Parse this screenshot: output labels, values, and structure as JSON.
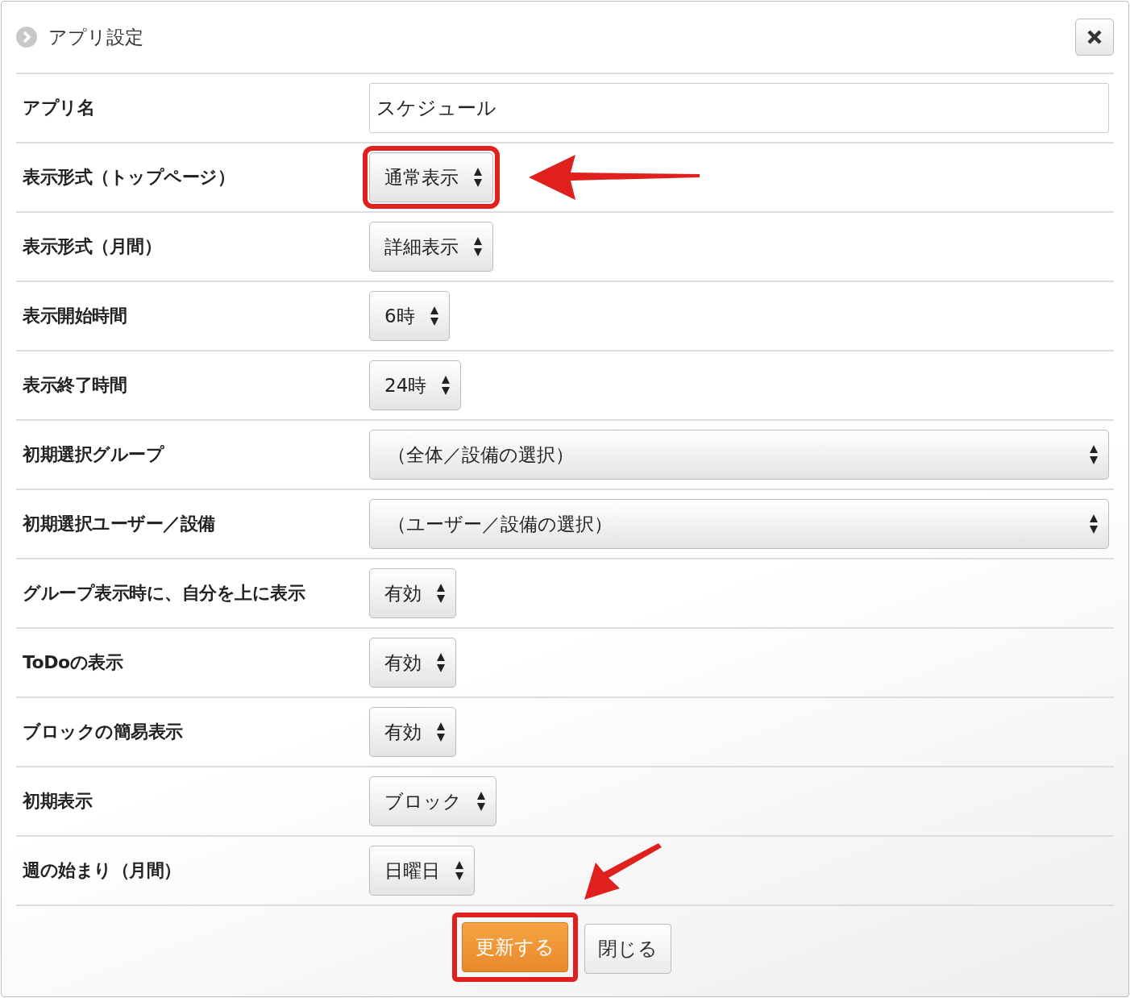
{
  "dialog": {
    "title": "アプリ設定"
  },
  "rows": [
    {
      "label": "アプリ名",
      "kind": "text",
      "value": "スケジュール",
      "wide": true,
      "highlighted": false
    },
    {
      "label": "表示形式（トップページ）",
      "kind": "select",
      "value": "通常表示",
      "wide": false,
      "highlighted": true
    },
    {
      "label": "表示形式（月間）",
      "kind": "select",
      "value": "詳細表示",
      "wide": false,
      "highlighted": false
    },
    {
      "label": "表示開始時間",
      "kind": "select",
      "value": "6時",
      "wide": false,
      "highlighted": false
    },
    {
      "label": "表示終了時間",
      "kind": "select",
      "value": "24時",
      "wide": false,
      "highlighted": false
    },
    {
      "label": "初期選択グループ",
      "kind": "select",
      "value": "（全体／設備の選択）",
      "wide": true,
      "highlighted": false
    },
    {
      "label": "初期選択ユーザー／設備",
      "kind": "select",
      "value": "（ユーザー／設備の選択）",
      "wide": true,
      "highlighted": false
    },
    {
      "label": "グループ表示時に、自分を上に表示",
      "kind": "select",
      "value": "有効",
      "wide": false,
      "highlighted": false
    },
    {
      "label": "ToDoの表示",
      "kind": "select",
      "value": "有効",
      "wide": false,
      "highlighted": false
    },
    {
      "label": "ブロックの簡易表示",
      "kind": "select",
      "value": "有効",
      "wide": false,
      "highlighted": false
    },
    {
      "label": "初期表示",
      "kind": "select",
      "value": "ブロック",
      "wide": false,
      "highlighted": false
    },
    {
      "label": "週の始まり（月間）",
      "kind": "select",
      "value": "日曜日",
      "wide": false,
      "highlighted": false
    }
  ],
  "buttons": [
    {
      "label": "更新する",
      "kind": "primary",
      "highlighted": true
    },
    {
      "label": "閉じる",
      "kind": "secondary",
      "highlighted": false
    }
  ]
}
